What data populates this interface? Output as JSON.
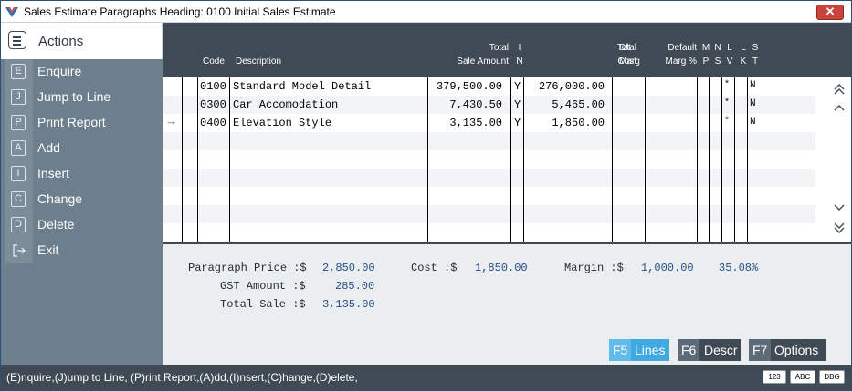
{
  "window": {
    "title": "Sales Estimate Paragraphs  Heading: 0100 Initial Sales Estimate",
    "close_glyph": "✕"
  },
  "sidebar": {
    "title": "Actions",
    "items": [
      {
        "key": "E",
        "label": "Enquire"
      },
      {
        "key": "J",
        "label": "Jump to Line"
      },
      {
        "key": "P",
        "label": "Print Report"
      },
      {
        "key": "A",
        "label": "Add"
      },
      {
        "key": "I",
        "label": "Insert"
      },
      {
        "key": "C",
        "label": "Change"
      },
      {
        "key": "D",
        "label": "Delete"
      },
      {
        "key": "exit-icon",
        "label": "Exit"
      }
    ]
  },
  "grid": {
    "headers": {
      "code": "Code",
      "description": "Description",
      "total_sale_amount_1": "Total",
      "total_sale_amount_2": "Sale Amount",
      "in_1": "I",
      "in_2": "N",
      "total_cost_1": "Total",
      "total_cost_2": "Cost",
      "dflt_marg_1": "Dft",
      "dflt_marg_2": "Marg",
      "default_marg_1": "Default",
      "default_marg_2": "Marg %",
      "mp_1": "M",
      "mp_2": "P",
      "ns_1": "N",
      "ns_2": "S",
      "lv_1": "L",
      "lv_2": "V",
      "lk_1": "L",
      "lk_2": "K",
      "st_1": "S",
      "st_2": "T"
    },
    "rows": [
      {
        "code": "0100",
        "description": "Standard Model Detail",
        "sale_amount": "379,500.00",
        "in": "Y",
        "cost": "276,000.00",
        "lv": "*",
        "st": "N"
      },
      {
        "code": "0300",
        "description": "Car Accomodation",
        "sale_amount": "7,430.50",
        "in": "Y",
        "cost": "5,465.00",
        "lv": "*",
        "st": "N"
      },
      {
        "code": "0400",
        "description": "Elevation Style",
        "sale_amount": "3,135.00",
        "in": "Y",
        "cost": "1,850.00",
        "lv": "*",
        "st": "N"
      }
    ],
    "current_row_marker": "→",
    "current_row_index": 2
  },
  "summary": {
    "paragraph_price_label": "Paragraph Price :$",
    "paragraph_price_value": "2,850.00",
    "cost_label": "Cost :$",
    "cost_value": "1,850.00",
    "margin_label": "Margin :$",
    "margin_value": "1,000.00",
    "margin_pct": "35.08%",
    "gst_label": "GST Amount :$",
    "gst_value": "285.00",
    "total_sale_label": "Total Sale :$",
    "total_sale_value": "3,135.00"
  },
  "function_buttons": [
    {
      "key": "F5",
      "label": "Lines",
      "color": "#3fa9e0"
    },
    {
      "key": "F6",
      "label": "Descr",
      "color": "#3f4a55"
    },
    {
      "key": "F7",
      "label": "Options",
      "color": "#3f4a55"
    }
  ],
  "statusbar": {
    "text": "(E)nquire,(J)ump to Line, (P)rint Report,(A)dd,(I)nsert,(C)hange,(D)elete,",
    "indicators": [
      "123",
      "ABC",
      "DBG"
    ]
  }
}
